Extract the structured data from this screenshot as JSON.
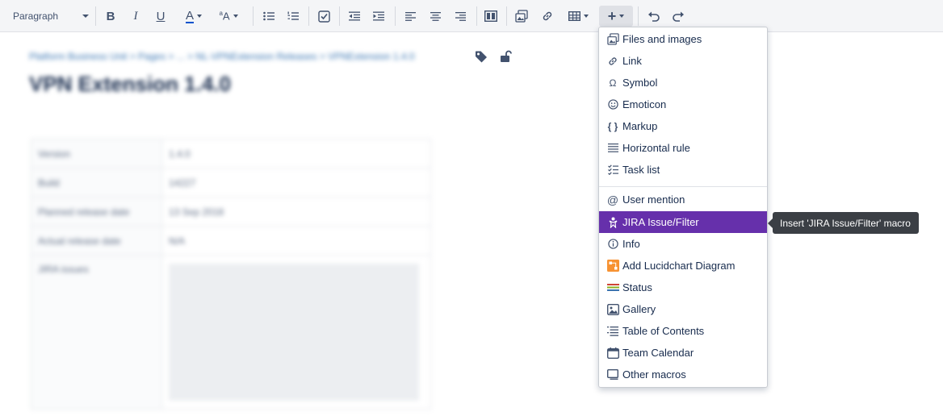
{
  "toolbar": {
    "paragraph_label": "Paragraph",
    "buttons": [
      "bold",
      "italic",
      "underline",
      "text-color",
      "text-size",
      "bullet-list",
      "numbered-list",
      "task-list",
      "outdent",
      "indent",
      "align-left",
      "align-center",
      "align-right",
      "page-layout",
      "files-images",
      "link",
      "table",
      "insert",
      "undo",
      "redo"
    ]
  },
  "page": {
    "breadcrumb": "Platform Business Unit  >  Pages  >  ...  >  NL-VPNExtension Releases  >  VPNExtension 1.4.0",
    "title": "VPN Extension 1.4.0",
    "rows": [
      {
        "key": "Version",
        "value": "1.4.0"
      },
      {
        "key": "Build",
        "value": "14227"
      },
      {
        "key": "Planned release date",
        "value": "13 Sep 2018"
      },
      {
        "key": "Actual release date",
        "value": "N/A"
      },
      {
        "key": "JIRA issues",
        "value": ""
      }
    ]
  },
  "menu": {
    "items": [
      {
        "label": "Files and images",
        "icon": "files-images-icon"
      },
      {
        "label": "Link",
        "icon": "link-icon"
      },
      {
        "label": "Symbol",
        "icon": "omega-icon"
      },
      {
        "label": "Emoticon",
        "icon": "smiley-icon"
      },
      {
        "label": "Markup",
        "icon": "braces-icon"
      },
      {
        "label": "Horizontal rule",
        "icon": "horizontal-rule-icon"
      },
      {
        "label": "Task list",
        "icon": "task-list-icon"
      },
      {
        "label": "User mention",
        "icon": "at-icon"
      },
      {
        "label": "JIRA Issue/Filter",
        "icon": "jira-icon"
      },
      {
        "label": "Info",
        "icon": "info-icon"
      },
      {
        "label": "Add Lucidchart Diagram",
        "icon": "lucidchart-icon"
      },
      {
        "label": "Status",
        "icon": "status-icon"
      },
      {
        "label": "Gallery",
        "icon": "gallery-icon"
      },
      {
        "label": "Table of Contents",
        "icon": "toc-icon"
      },
      {
        "label": "Team Calendar",
        "icon": "calendar-icon"
      },
      {
        "label": "Other macros",
        "icon": "macros-icon"
      }
    ],
    "active_index": 8
  },
  "tooltip": "Insert 'JIRA Issue/Filter' macro",
  "colors": {
    "accent": "#6630ab",
    "tooltip_bg": "#3b3f45",
    "toolbar_bg": "#f4f5f7"
  }
}
